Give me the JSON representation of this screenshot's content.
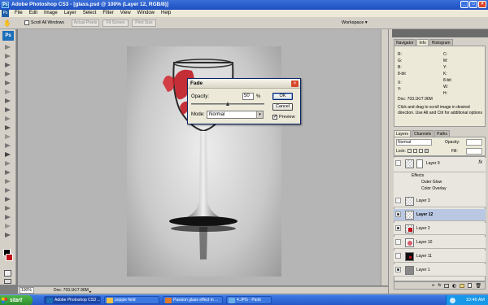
{
  "window": {
    "title": "Adobe Photoshop CS3 - [glass.psd @ 100% (Layer 12, RGB/8)]"
  },
  "menu": [
    "File",
    "Edit",
    "Image",
    "Layer",
    "Select",
    "Filter",
    "View",
    "Window",
    "Help"
  ],
  "options": {
    "scroll_all": "Scroll All Windows",
    "actual_pixels": "Actual Pixels",
    "fit_screen": "Fit Screen",
    "print_size": "Print Size",
    "workspace": "Workspace ▾"
  },
  "dialog": {
    "title": "Fade",
    "opacity_label": "Opacity:",
    "opacity_value": "50",
    "opacity_unit": "%",
    "opacity_level": 0.5,
    "mode_label": "Mode:",
    "mode_value": "Normal",
    "ok": "OK",
    "cancel": "Cancel",
    "preview": "Preview"
  },
  "navigator": {
    "tabs": [
      "Navigator",
      "Info",
      "Histogram"
    ],
    "active_tab": "Info",
    "info_rows": [
      "R:",
      "G:",
      "B:",
      "8-bit",
      "X:",
      "Y:",
      "C:",
      "M:",
      "Y:",
      "K:",
      "8-bit",
      "W:",
      "H:"
    ],
    "doc": "Doc: 703.1K/7.96M",
    "hint": "Click and drag to scroll image in desired direction. Use Alt and Ctrl for additional options"
  },
  "layers": {
    "tabs": [
      "Layers",
      "Channels",
      "Paths"
    ],
    "blend": "Normal",
    "opacity_label": "Opacity:",
    "lock_label": "Lock:",
    "fill_label": "Fill:",
    "fx": "fx",
    "items": [
      {
        "name": "Layer 9",
        "effects": [
          "Effects",
          "Outer Glow",
          "Color Overlay"
        ]
      },
      {
        "name": "Layer 3"
      },
      {
        "name": "Layer 12",
        "selected": true
      },
      {
        "name": "Layer 2"
      },
      {
        "name": "Layer 10"
      },
      {
        "name": "Layer 11"
      },
      {
        "name": "Layer 1"
      }
    ]
  },
  "status": {
    "zoom": "100%",
    "doc": "Doc: 703.1K/7.96M"
  },
  "taskbar": {
    "start": "start",
    "tasks": [
      "Adobe Photoshop CS3 ...",
      "poppie field",
      "Passion glass effect in ...",
      "4.JPG - Paint"
    ],
    "clock": "10:46 AM"
  },
  "colors": {
    "accent_red": "#c0101a",
    "xp_blue": "#2658c8",
    "selected_layer": "#b9c7e3"
  }
}
